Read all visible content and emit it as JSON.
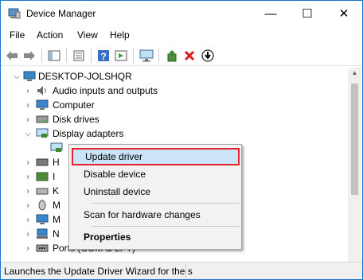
{
  "window": {
    "title": "Device Manager",
    "controls": {
      "minimize": "—",
      "maximize": "☐",
      "close": "✕"
    }
  },
  "menu": [
    "File",
    "Action",
    "View",
    "Help"
  ],
  "toolbar": {
    "buttons": [
      "back-icon",
      "forward-icon",
      "show-hide-console-tree-icon",
      "properties-icon",
      "help-icon",
      "action-pane-icon",
      "monitor-icon",
      "update-driver-icon",
      "uninstall-icon",
      "download-icon"
    ]
  },
  "tree": {
    "root": "DESKTOP-JOLSHQR",
    "items": [
      {
        "label": "Audio inputs and outputs",
        "icon": "speaker-icon",
        "expanded": false
      },
      {
        "label": "Computer",
        "icon": "computer-icon",
        "expanded": false
      },
      {
        "label": "Disk drives",
        "icon": "disk-drive-icon",
        "expanded": false
      },
      {
        "label": "Display adapters",
        "icon": "display-adapter-icon",
        "expanded": true
      },
      {
        "label": "",
        "icon": "display-adapter-icon",
        "child": true
      },
      {
        "label": "H",
        "icon": "hid-icon",
        "expanded": false
      },
      {
        "label": "I",
        "icon": "ide-icon",
        "expanded": false
      },
      {
        "label": "K",
        "icon": "keyboard-icon",
        "expanded": false
      },
      {
        "label": "M",
        "icon": "mice-icon",
        "expanded": false
      },
      {
        "label": "M",
        "icon": "monitor-icon",
        "expanded": false
      },
      {
        "label": "N",
        "icon": "network-icon",
        "expanded": false
      },
      {
        "label": "Ports (COM & LPT)",
        "icon": "port-icon",
        "expanded": false
      }
    ]
  },
  "context_menu": {
    "items": [
      {
        "label": "Update driver",
        "highlighted": true
      },
      {
        "label": "Disable device"
      },
      {
        "label": "Uninstall device"
      },
      {
        "separator": true
      },
      {
        "label": "Scan for hardware changes"
      },
      {
        "separator": true
      },
      {
        "label": "Properties",
        "bold": true
      }
    ]
  },
  "status": {
    "text": "Launches the Update Driver Wizard for the s"
  },
  "colors": {
    "window_border": "#1a73c9",
    "highlight_border": "#e8212b",
    "highlight_fill": "#cce4f7"
  }
}
